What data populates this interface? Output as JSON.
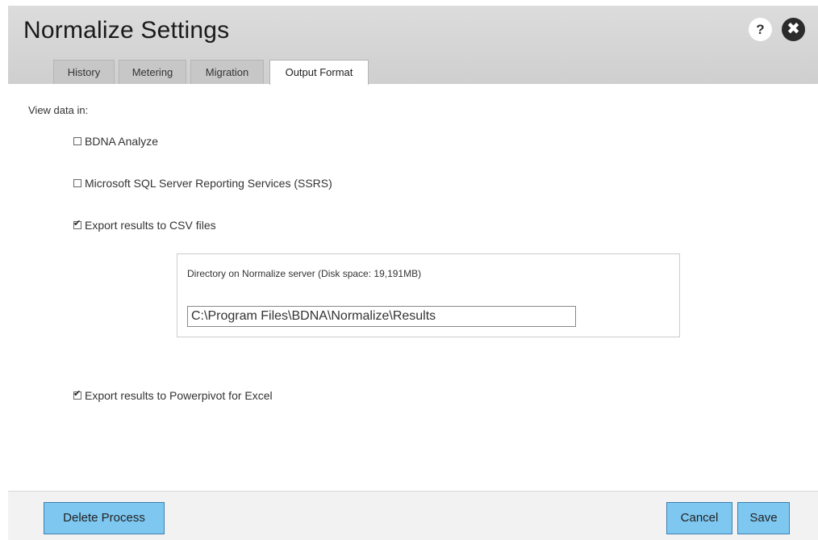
{
  "header": {
    "title": "Normalize Settings",
    "help_icon": "?",
    "close_icon": "✖"
  },
  "tabs": [
    {
      "label": "History",
      "active": false
    },
    {
      "label": "Metering",
      "active": false
    },
    {
      "label": "Migration",
      "active": false
    },
    {
      "label": "Output Format",
      "active": true
    }
  ],
  "output": {
    "view_label": "View data in:",
    "options": [
      {
        "label": "BDNA Analyze",
        "checked": false
      },
      {
        "label": "Microsoft SQL Server Reporting Services (SSRS)",
        "checked": false
      },
      {
        "label": "Export results to CSV files",
        "checked": true
      },
      {
        "label": "Export results to Powerpivot for Excel",
        "checked": true
      }
    ],
    "directory_label": "Directory on Normalize server (Disk space: 19,191MB)",
    "directory_value": "C:\\Program Files\\BDNA\\Normalize\\Results"
  },
  "footer": {
    "delete_label": "Delete Process",
    "cancel_label": "Cancel",
    "save_label": "Save"
  },
  "colors": {
    "header_bg": "#d6d6d6",
    "button_bg": "#7ec7f0",
    "button_border": "#3f7fb0"
  }
}
